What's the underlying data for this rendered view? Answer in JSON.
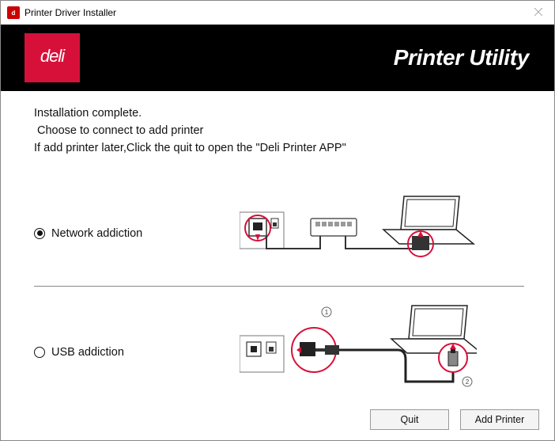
{
  "window": {
    "title": "Printer Driver Installer",
    "appicon_text": "deli"
  },
  "banner": {
    "logo_text": "deli",
    "product_title": "Printer Utility"
  },
  "messages": {
    "line1": "Installation complete.",
    "line2": " Choose to connect to add printer",
    "line3": "If add printer later,Click the quit to open the \"Deli Printer APP\""
  },
  "options": {
    "network": {
      "label": "Network addiction",
      "selected": true
    },
    "usb": {
      "label": "USB addiction",
      "selected": false
    }
  },
  "buttons": {
    "quit": "Quit",
    "add_printer": "Add Printer"
  }
}
